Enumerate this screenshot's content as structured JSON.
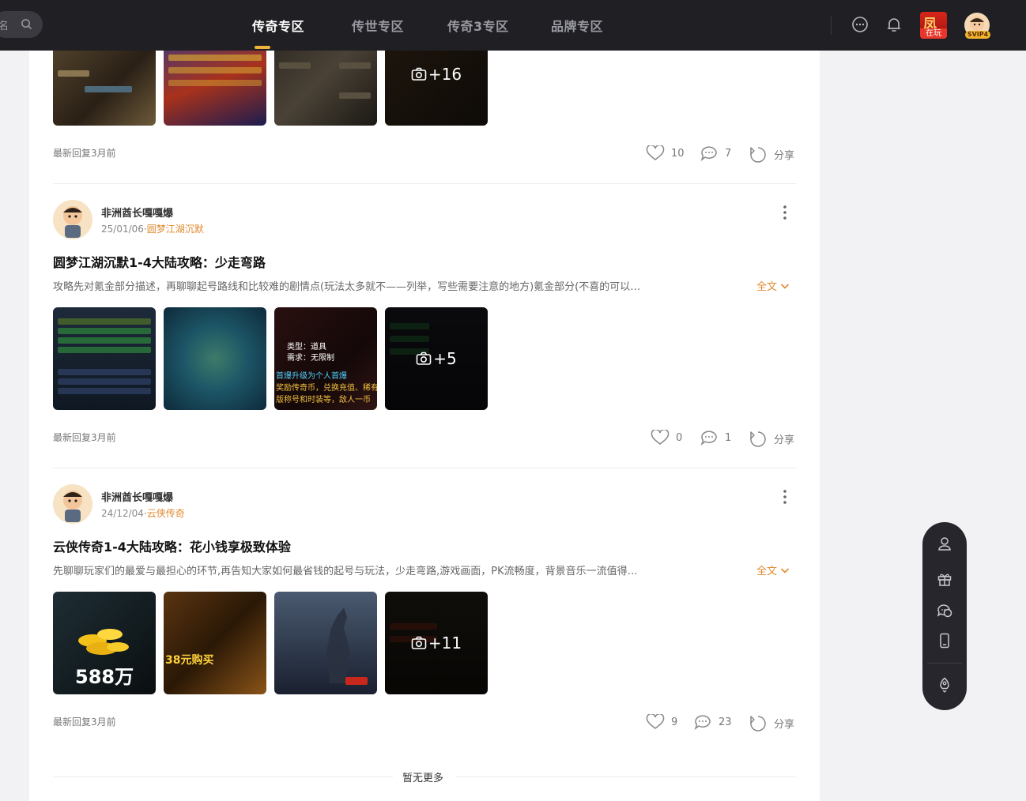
{
  "topbar": {
    "search_placeholder": "名",
    "tabs": [
      {
        "label": "传奇专区",
        "active": true
      },
      {
        "label": "传世专区",
        "active": false
      },
      {
        "label": "传奇3专区",
        "active": false
      },
      {
        "label": "品牌专区",
        "active": false
      }
    ],
    "icons": [
      "chat-icon",
      "bell-icon"
    ],
    "game_badge": {
      "char": "凤",
      "tag": "在玩"
    },
    "vip_label": "SVIP4"
  },
  "posts": [
    {
      "partial": true,
      "images_more": "+16",
      "reply_time": "最新回复3月前",
      "likes": "10",
      "comments": "7",
      "share_label": "分享"
    },
    {
      "author": "非洲酋长嘎嘎爆",
      "date": "25/01/06",
      "game": "圆梦江湖沉默",
      "title": "圆梦江湖沉默1-4大陆攻略：少走弯路",
      "summary": "攻略先对氪金部分描述，再聊聊起号路线和比较难的剧情点(玩法太多就不——列举，写些需要注意的地方)氪金部分(不喜的可以…",
      "fulltext_label": "全文",
      "images_more": "+5",
      "image_texts": {
        "img3": [
          "类型：道具",
          "需求：无限制",
          "首爆升级为个人首爆",
          "奖励传奇币，兑换充值、稀有",
          "版称号和时装等，敌人一币"
        ]
      },
      "reply_time": "最新回复3月前",
      "likes": "0",
      "comments": "1",
      "share_label": "分享"
    },
    {
      "author": "非洲酋长嘎嘎爆",
      "date": "24/12/04",
      "game": "云侠传奇",
      "title": "云侠传奇1-4大陆攻略：花小钱享极致体验",
      "summary": "先聊聊玩家们的最爱与最担心的环节,再告知大家如何最省钱的起号与玩法，少走弯路,游戏画面，PK流畅度，背景音乐一流值得…",
      "fulltext_label": "全文",
      "images_more": "+11",
      "image_texts": {
        "img1": "588万",
        "img2": "38元购买"
      },
      "reply_time": "最新回复3月前",
      "likes": "9",
      "comments": "23",
      "share_label": "分享"
    }
  ],
  "footer": {
    "no_more": "暂无更多"
  },
  "side_tools": [
    "user-icon",
    "gift-icon",
    "service-icon",
    "phone-icon",
    "rocket-icon"
  ],
  "colors": {
    "accent": "#e08a2f",
    "nav_bg": "#1f1f24",
    "underline": "#f0b43c"
  }
}
